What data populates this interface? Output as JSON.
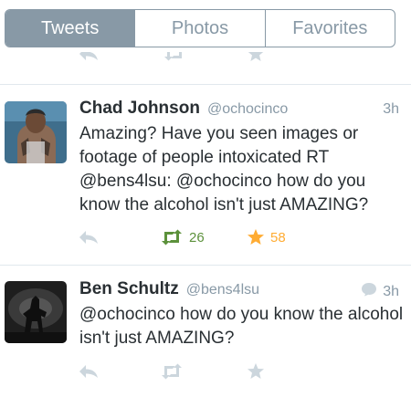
{
  "tabs": [
    {
      "label": "Tweets",
      "active": true
    },
    {
      "label": "Photos",
      "active": false
    },
    {
      "label": "Favorites",
      "active": false
    }
  ],
  "colors": {
    "active_tab_bg": "#8899a6",
    "retweeted_green": "#5c913b",
    "favorited_gold": "#ffac33",
    "inactive_icon": "#ccd6dd"
  },
  "tweets": [
    {
      "name": "Chad Johnson",
      "handle": "@ochocinco",
      "time": "3h",
      "text": "Amazing? Have you seen images or footage of people intoxicated RT @bens4lsu: @ochocinco how do you know the alcohol isn't just AMAZING?",
      "retweets": "26",
      "favorites": "58",
      "icons": [
        "reply-icon",
        "retweet-icon",
        "favorite-star-icon"
      ]
    },
    {
      "name": "Ben Schultz",
      "handle": "@bens4lsu",
      "time": "3h",
      "in_conversation_icon": "speech-bubble-icon",
      "text": "@ochocinco how do you know the alcohol isn't just AMAZING?",
      "icons": [
        "reply-icon",
        "retweet-icon",
        "favorite-star-icon"
      ]
    }
  ]
}
